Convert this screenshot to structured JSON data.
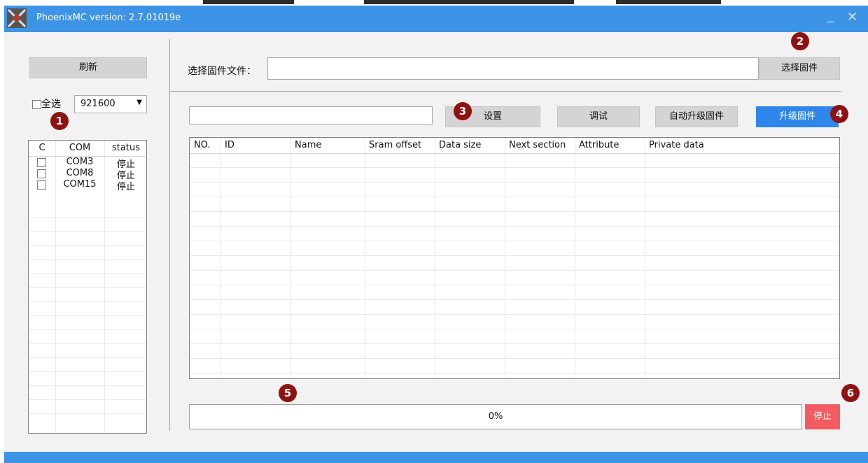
{
  "window": {
    "title": "PhoenixMC version: 2.7.01019e",
    "minimize": "_",
    "close": "✕"
  },
  "colors": {
    "titlebar": "#3d93e6",
    "marker": "#8f1212",
    "primary_button": "#2f86ea",
    "stop_button": "#f25b5f"
  },
  "left_panel": {
    "refresh_label": "刷新",
    "select_all_label": "全选",
    "baud_rate": "921600",
    "columns": [
      "C",
      "COM",
      "status"
    ],
    "ports": [
      {
        "com": "COM3",
        "status": "停止"
      },
      {
        "com": "COM8",
        "status": "停止"
      },
      {
        "com": "COM15",
        "status": "停止"
      }
    ]
  },
  "firmware": {
    "label": "选择固件文件：",
    "path_value": "",
    "choose_button": "选择固件"
  },
  "actions": {
    "command_value": "",
    "settings": "设置",
    "debug": "调试",
    "auto_upgrade": "自动升级固件",
    "upgrade": "升级固件"
  },
  "table": {
    "columns": [
      "NO.",
      "ID",
      "Name",
      "Sram offset",
      "Data size",
      "Next section",
      "Attribute",
      "Private data"
    ],
    "rows": []
  },
  "progress": {
    "value": 0,
    "label": "0%"
  },
  "stop_button": "停止",
  "markers": [
    "1",
    "2",
    "3",
    "4",
    "5",
    "6"
  ]
}
